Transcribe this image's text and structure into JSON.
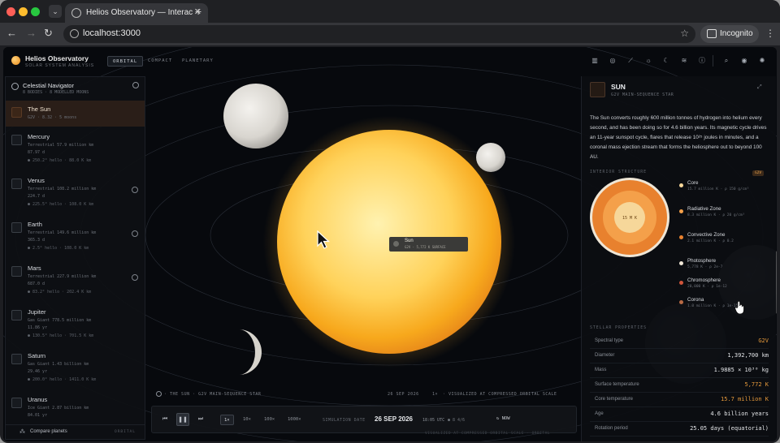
{
  "browser": {
    "tab_title": "Helios Observatory — Interac",
    "url": "localhost:3000",
    "incognito_label": "Incognito",
    "colors": {
      "red": "#ff5f57",
      "yellow": "#febc2e",
      "green": "#28c840"
    }
  },
  "header": {
    "brand": "Helios Observatory",
    "brand_sub": "SOLAR SYSTEM ANALYSIS",
    "modes": [
      "ORBITAL",
      "COMPACT",
      "PLANETARY"
    ],
    "active_mode": "ORBITAL",
    "icons": [
      "bar-chart-icon",
      "compass-icon",
      "ruler-icon",
      "sun-icon",
      "moon-icon",
      "layers-icon",
      "info-icon",
      "search-icon",
      "eye-icon",
      "settings-icon"
    ]
  },
  "sidebar": {
    "title": "Celestial Navigator",
    "subtitle": "8 BODIES · 8 MODELLED MOONS",
    "items": [
      {
        "name": "The Sun",
        "type": "G2V · 8.32 · 5 moons",
        "period": "",
        "temp": ""
      },
      {
        "name": "Mercury",
        "type": "Terrestrial   57.9 million km",
        "period": "87.97 d",
        "temp": "● 250.2° hello · 88.0 K km"
      },
      {
        "name": "Venus",
        "type": "Terrestrial   108.2 million km",
        "period": "224.7 d",
        "temp": "● 225.5° hello · 108.0 K km"
      },
      {
        "name": "Earth",
        "type": "Terrestrial   149.6 million km",
        "period": "365.3 d",
        "temp": "● 2.5° hello · 108.0 K km"
      },
      {
        "name": "Mars",
        "type": "Terrestrial   227.9 million km",
        "period": "687.0 d",
        "temp": "● 83.2° hello · 202.4 K km"
      },
      {
        "name": "Jupiter",
        "type": "Gas Giant   778.5 million km",
        "period": "11.86 yr",
        "temp": "● 130.5° hello · 701.5 K km"
      },
      {
        "name": "Saturn",
        "type": "Gas Giant   1.43 billion km",
        "period": "29.46 yr",
        "temp": "● 200.0° hello · 1411.0 K km"
      },
      {
        "name": "Uranus",
        "type": "Ice Giant   2.87 billion km",
        "period": "84.01 yr",
        "temp": ""
      }
    ],
    "compare_label": "Compare planets",
    "orbital_label": "ORBITAL"
  },
  "tooltip": {
    "name": "Sun",
    "info": "G2V · 5,772 K SURFACE"
  },
  "caption": {
    "left": "· THE SUN · G2V MAIN-SEQUENCE STAR",
    "date": "26 SEP 2026",
    "mid": "1×",
    "right": "· VISUALIZED AT COMPRESSED ORBITAL SCALE"
  },
  "controls": {
    "speeds": [
      "1×",
      "10×",
      "100×",
      "1000×"
    ],
    "active_speed": "1×",
    "sim_label": "SIMULATION DATE",
    "date": "26 SEP 2026",
    "time": "18:05 UTC",
    "tz": "● 8 4/6",
    "now_label": "NOW"
  },
  "footer_note": "VISUALIZED AT COMPRESSED ORBITAL SCALE · ORBITAL",
  "panel": {
    "title": "SUN",
    "subtitle": "G2V MAIN-SEQUENCE STAR",
    "description": "The Sun converts roughly 600 million tonnes of hydrogen into helium every second, and has been doing so for 4.6 billion years. Its magnetic cycle drives an 11-year sunspot cycle, flares that release 10²⁵ joules in minutes, and a coronal mass ejection stream that forms the heliosphere out to beyond 100 AU.",
    "interior_label": "INTERIOR STRUCTURE",
    "interior_badge": "G2V",
    "core_label": "15 M K",
    "layers": [
      {
        "name": "Core",
        "value": "15.7 million K · ρ 150 g/cm³",
        "color": "#f6d79a"
      },
      {
        "name": "Radiative Zone",
        "value": "8.3 million K · ρ 20 g/cm³",
        "color": "#f4a04a"
      },
      {
        "name": "Convective Zone",
        "value": "2.1 million K · ρ 0.2",
        "color": "#e8812e"
      },
      {
        "name": "Photosphere",
        "value": "5,778 K · ρ 2e-7",
        "color": "#efe6d6"
      },
      {
        "name": "Chromosphere",
        "value": "20,000 K · ρ 1e-12",
        "color": "#d0553b"
      },
      {
        "name": "Corona",
        "value": "1.0 million K · ρ 1e-15",
        "color": "#b86a45"
      }
    ],
    "stellar_label": "STELLAR PROPERTIES",
    "properties": [
      {
        "k": "Spectral type",
        "v": "G2V",
        "accent": true
      },
      {
        "k": "Diameter",
        "v": "1,392,700 km",
        "accent": false
      },
      {
        "k": "Mass",
        "v": "1.9885 × 10³⁰ kg",
        "accent": false
      },
      {
        "k": "Surface temperature",
        "v": "5,772 K",
        "accent": true
      },
      {
        "k": "Core temperature",
        "v": "15.7 million K",
        "accent": true
      },
      {
        "k": "Age",
        "v": "4.6 billion years",
        "accent": false
      },
      {
        "k": "Rotation period",
        "v": "25.05 days (equatorial)",
        "accent": false
      }
    ],
    "accent_color": "#e79a3c"
  }
}
